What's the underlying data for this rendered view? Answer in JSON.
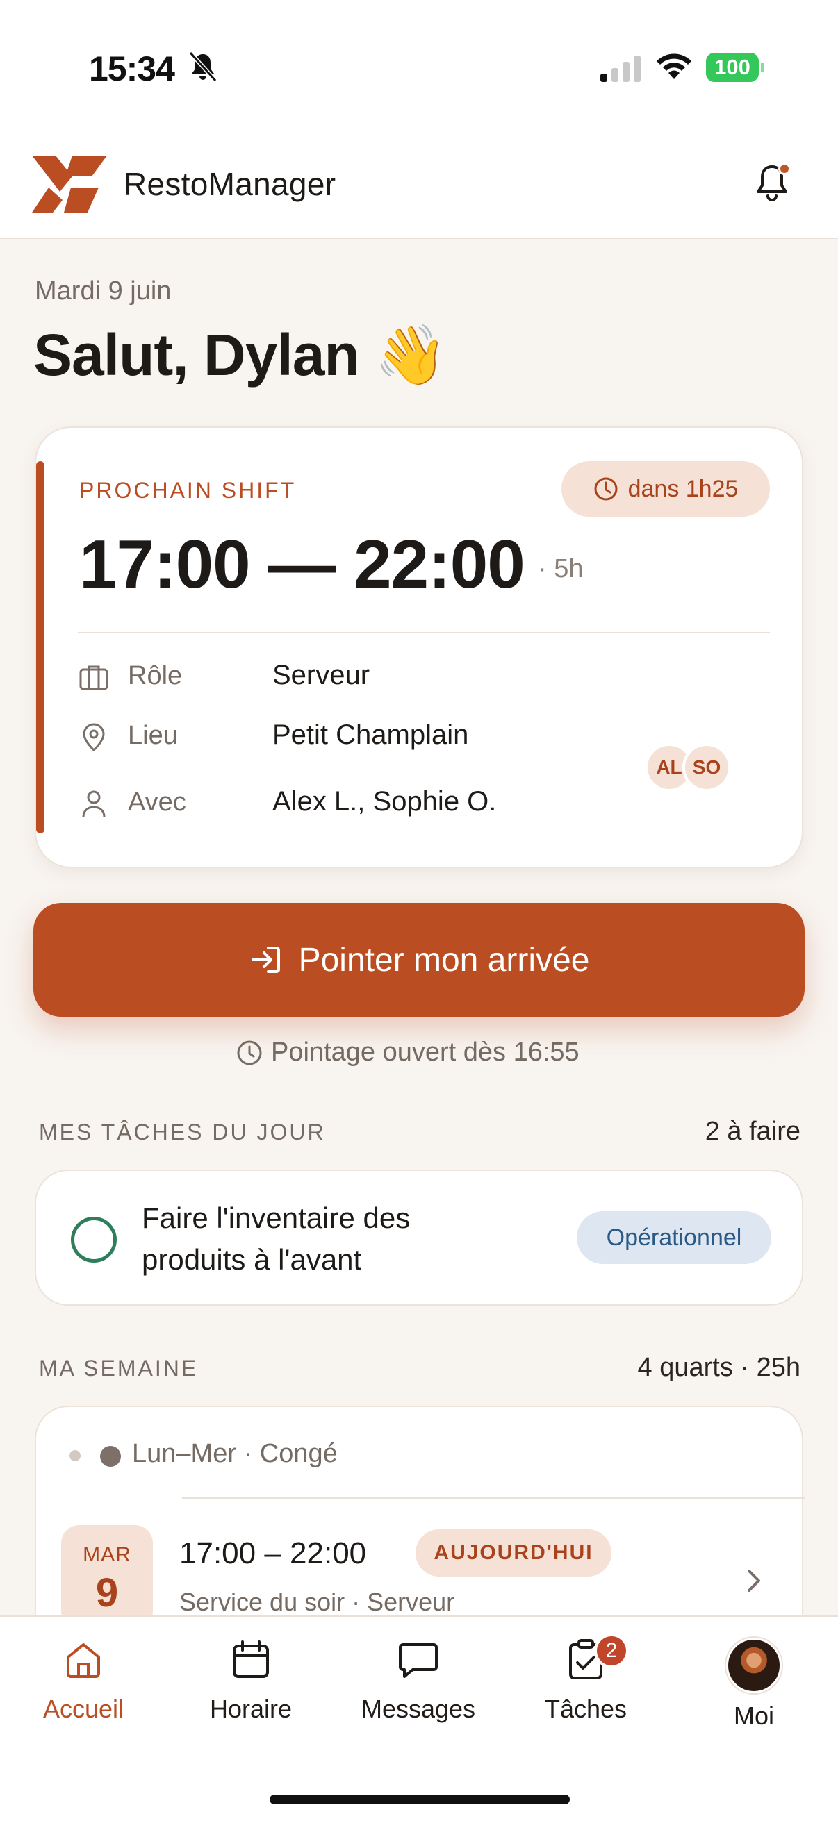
{
  "status_bar": {
    "time": "15:34",
    "battery": "100"
  },
  "header": {
    "app_name": "RestoManager"
  },
  "greeting": {
    "date": "Mardi 9 juin",
    "title": "Salut, Dylan 👋"
  },
  "next_shift": {
    "label": "PROCHAIN SHIFT",
    "countdown": "dans 1h25",
    "time_range": "17:00 — 22:00",
    "duration": "· 5h",
    "rows": [
      {
        "label": "Rôle",
        "value": "Serveur"
      },
      {
        "label": "Lieu",
        "value": "Petit Champlain"
      },
      {
        "label": "Avec",
        "value": "Alex L., Sophie O."
      }
    ],
    "coworker_initials": [
      "AL",
      "SO"
    ]
  },
  "clock_in": {
    "button_label": "Pointer mon arrivée",
    "note": "Pointage ouvert dès 16:55"
  },
  "tasks": {
    "title": "MES TÂCHES DU JOUR",
    "count": "2 à faire",
    "items": [
      {
        "text": "Faire l'inventaire des produits à l'avant",
        "tag": "Opérationnel"
      }
    ]
  },
  "week": {
    "title": "MA SEMAINE",
    "summary": "4 quarts · 25h",
    "off_line": "Lun–Mer · Congé",
    "shift": {
      "day_abbr": "MAR",
      "day_num": "9",
      "time": "17:00 – 22:00",
      "tag": "AUJOURD'HUI",
      "subtitle": "Service du soir · Serveur"
    }
  },
  "tabs": [
    {
      "label": "Accueil",
      "icon": "home-icon",
      "active": true
    },
    {
      "label": "Horaire",
      "icon": "calendar-icon"
    },
    {
      "label": "Messages",
      "icon": "message-icon"
    },
    {
      "label": "Tâches",
      "icon": "task-icon",
      "badge": "2"
    },
    {
      "label": "Moi",
      "icon": "avatar"
    }
  ],
  "colors": {
    "accent": "#bb4d22",
    "accent_soft": "#f5e1d6",
    "background": "#f8f4f0",
    "tag_blue": "#dde6f1",
    "check_green": "#2e7d5b"
  }
}
